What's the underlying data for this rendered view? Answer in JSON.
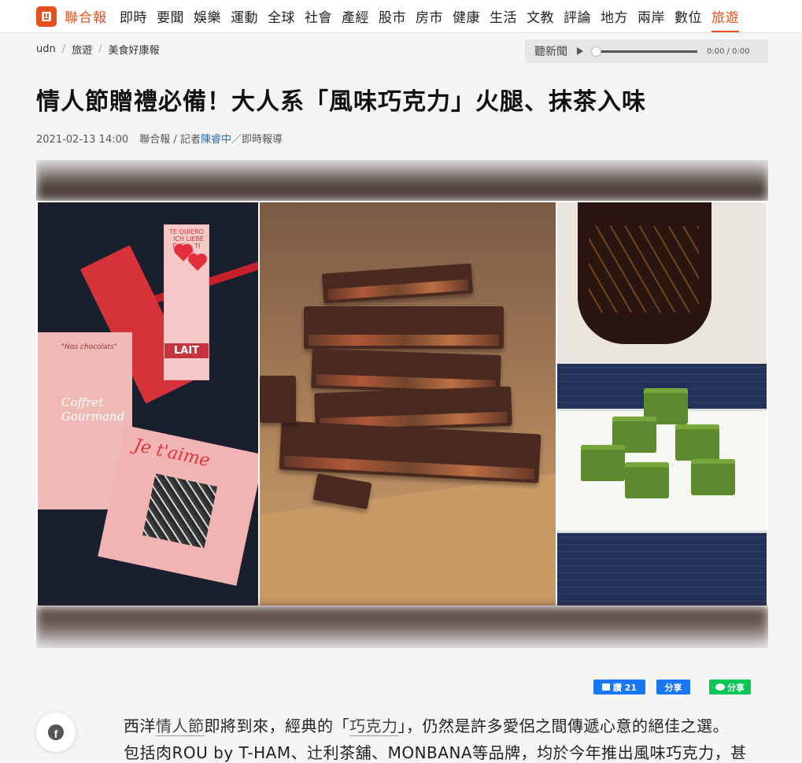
{
  "nav": {
    "brand": "聯合報",
    "items": [
      "即時",
      "要聞",
      "娛樂",
      "運動",
      "全球",
      "社會",
      "產經",
      "股市",
      "房市",
      "健康",
      "生活",
      "文教",
      "評論",
      "地方",
      "兩岸",
      "數位"
    ],
    "active": "旅遊"
  },
  "breadcrumb": [
    "udn",
    "旅遊",
    "美食好康報"
  ],
  "player": {
    "label": "聽新聞",
    "time": "0:00 / 0:00"
  },
  "article": {
    "title": "情人節贈禮必備！大人系「風味巧克力」火腿、抹茶入味",
    "date": "2021-02-13 14:00",
    "source": "聯合報 / 記者",
    "reporter": "陳睿中",
    "desk": "／即時報導"
  },
  "photo": {
    "panel1": {
      "tag_lines": "TE QUIERO · ICH LIEBE DICH · TI AMO",
      "lait": "LAIT",
      "coffret_top": "\"Nos chocolats\"",
      "coffret_main": "Coffret Gourmand",
      "jetaime": "Je t'aime"
    }
  },
  "share": {
    "like_label": "讚 21",
    "fb_share_label": "分享",
    "line_share_label": "分享"
  },
  "body": {
    "line1_a": "西洋",
    "line1_kw1": "情人節",
    "line1_b": "即將到來，經典的「",
    "line1_kw2": "巧克力",
    "line1_c": "」，仍然是許多愛侶之間傳遞心意的絕佳之選。",
    "line2": "包括肉ROU by T-HAM、辻利茶舖、MONBANA等品牌，均於今年推出風味巧克力，甚"
  },
  "colors": {
    "brand": "#e8501b",
    "link": "#2b6bb5",
    "facebook": "#1877f2",
    "line": "#06c755"
  }
}
